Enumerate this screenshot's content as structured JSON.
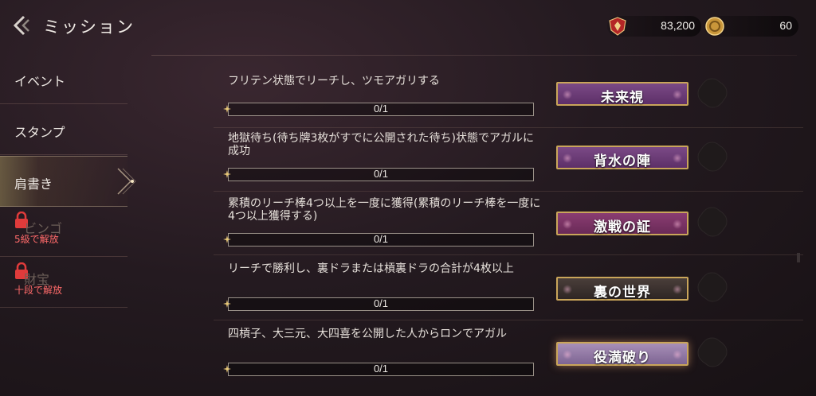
{
  "header": {
    "title": "ミッション",
    "points": "83,200",
    "coins": "60"
  },
  "sidebar": {
    "items": [
      {
        "label": "イベント"
      },
      {
        "label": "スタンプ"
      },
      {
        "label": "肩書き"
      },
      {
        "label": "ビンゴ",
        "requirement": "5級で解放"
      },
      {
        "label": "財宝",
        "requirement": "十段で解放"
      }
    ]
  },
  "missions": [
    {
      "description": "フリテン状態でリーチし、ツモアガリする",
      "progress": "0/1",
      "reward": "未来視",
      "style": "purple"
    },
    {
      "description": "地獄待ち(待ち牌3枚がすでに公開された待ち)状態でアガルに成功",
      "progress": "0/1",
      "reward": "背水の陣",
      "style": "purple"
    },
    {
      "description": "累積のリーチ棒4つ以上を一度に獲得(累積のリーチ棒を一度に4つ以上獲得する)",
      "progress": "0/1",
      "reward": "激戦の証",
      "style": "magenta"
    },
    {
      "description": "リーチで勝利し、裏ドラまたは槓裏ドラの合計が4枚以上",
      "progress": "0/1",
      "reward": "裏の世界",
      "style": "dark"
    },
    {
      "description": "四槓子、大三元、大四喜を公開した人からロンでアガル",
      "progress": "0/1",
      "reward": "役満破り",
      "style": "lavender"
    }
  ],
  "colors": {
    "accent_gold": "#c9a55a",
    "locked_red": "#ff6a6a"
  }
}
